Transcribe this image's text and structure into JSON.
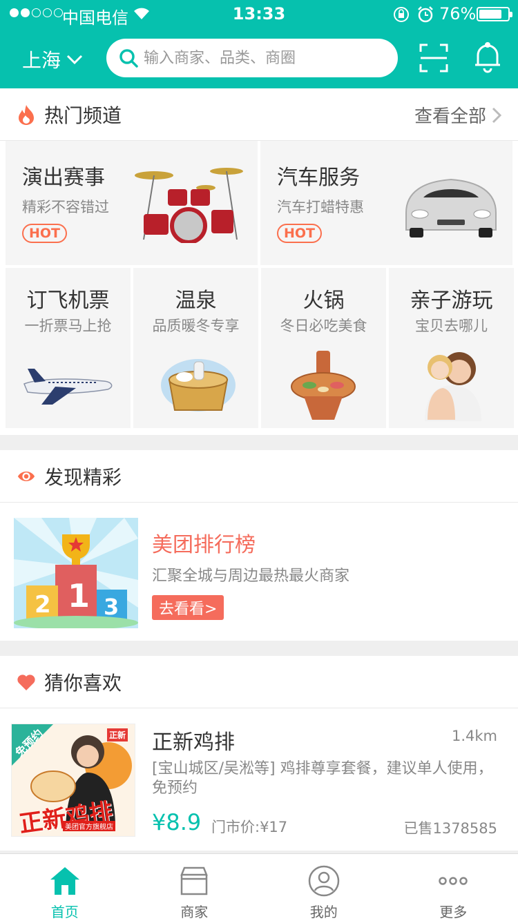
{
  "status_bar": {
    "carrier": "中国电信",
    "time": "13:33",
    "battery": "76%",
    "signal_bars": 2
  },
  "header": {
    "city": "上海",
    "search_placeholder": "输入商家、品类、商圈"
  },
  "hot_channels": {
    "title": "热门频道",
    "see_all": "查看全部",
    "large": [
      {
        "title": "演出赛事",
        "subtitle": "精彩不容错过",
        "badge": "HOT"
      },
      {
        "title": "汽车服务",
        "subtitle": "汽车打蜡特惠",
        "badge": "HOT"
      }
    ],
    "small": [
      {
        "title": "订飞机票",
        "subtitle": "一折票马上抢"
      },
      {
        "title": "温泉",
        "subtitle": "品质暖冬专享"
      },
      {
        "title": "火锅",
        "subtitle": "冬日必吃美食"
      },
      {
        "title": "亲子游玩",
        "subtitle": "宝贝去哪儿"
      }
    ]
  },
  "discover": {
    "title": "发现精彩",
    "item_title": "美团排行榜",
    "item_subtitle": "汇聚全城与周边最热最火商家",
    "item_button": "去看看>",
    "podium": [
      "2",
      "1",
      "3"
    ]
  },
  "guess": {
    "title": "猜你喜欢",
    "deals": [
      {
        "name": "正新鸡排",
        "distance": "1.4km",
        "description": "[宝山城区/吴淞等] 鸡排尊享套餐，建议单人使用，免预约",
        "price": "¥8.9",
        "original_price": "门市价:¥17",
        "sold": "已售1378585",
        "image_ribbon": "免预约",
        "image_logo": "正新",
        "image_title": "正新鸡排",
        "image_store": "美团官方旗舰店"
      }
    ]
  },
  "tabbar": {
    "tabs": [
      {
        "label": "首页",
        "icon": "home-icon"
      },
      {
        "label": "商家",
        "icon": "store-icon"
      },
      {
        "label": "我的",
        "icon": "user-icon"
      },
      {
        "label": "更多",
        "icon": "more-icon"
      }
    ]
  },
  "colors": {
    "brand": "#06c1ae",
    "accent": "#f56c5c",
    "hot": "#fb6f4d"
  }
}
